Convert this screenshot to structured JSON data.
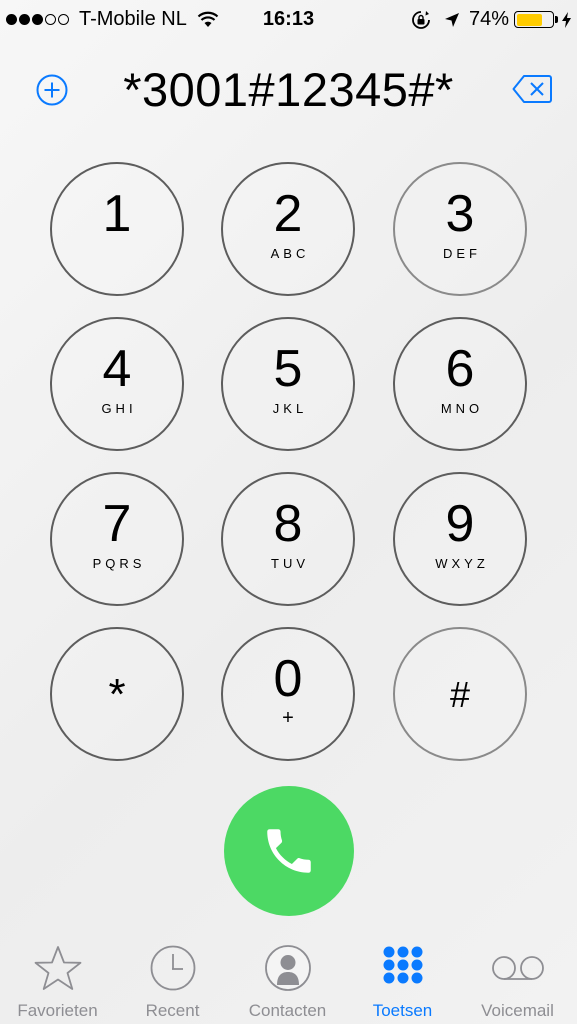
{
  "status_bar": {
    "carrier": "T-Mobile NL",
    "time": "16:13",
    "battery_percent": "74%",
    "battery_level": 0.74,
    "signal_bars": 3,
    "signal_max": 5
  },
  "dialer": {
    "number": "*3001#12345#*"
  },
  "keypad": {
    "keys": [
      {
        "digit": "1",
        "letters": ""
      },
      {
        "digit": "2",
        "letters": "ABC"
      },
      {
        "digit": "3",
        "letters": "DEF"
      },
      {
        "digit": "4",
        "letters": "GHI"
      },
      {
        "digit": "5",
        "letters": "JKL"
      },
      {
        "digit": "6",
        "letters": "MNO"
      },
      {
        "digit": "7",
        "letters": "PQRS"
      },
      {
        "digit": "8",
        "letters": "TUV"
      },
      {
        "digit": "9",
        "letters": "WXYZ"
      },
      {
        "digit": "*",
        "letters": ""
      },
      {
        "digit": "0",
        "letters": "+"
      },
      {
        "digit": "#",
        "letters": ""
      }
    ]
  },
  "tabs": [
    {
      "label": "Favorieten",
      "icon": "star-icon",
      "active": false
    },
    {
      "label": "Recent",
      "icon": "clock-icon",
      "active": false
    },
    {
      "label": "Contacten",
      "icon": "contact-icon",
      "active": false
    },
    {
      "label": "Toetsen",
      "icon": "keypad-icon",
      "active": true
    },
    {
      "label": "Voicemail",
      "icon": "voicemail-icon",
      "active": false
    }
  ],
  "colors": {
    "accent": "#0a7aff",
    "call_green": "#4cd964",
    "battery_yellow": "#ffcc00",
    "inactive_tab": "#8e8e93"
  }
}
